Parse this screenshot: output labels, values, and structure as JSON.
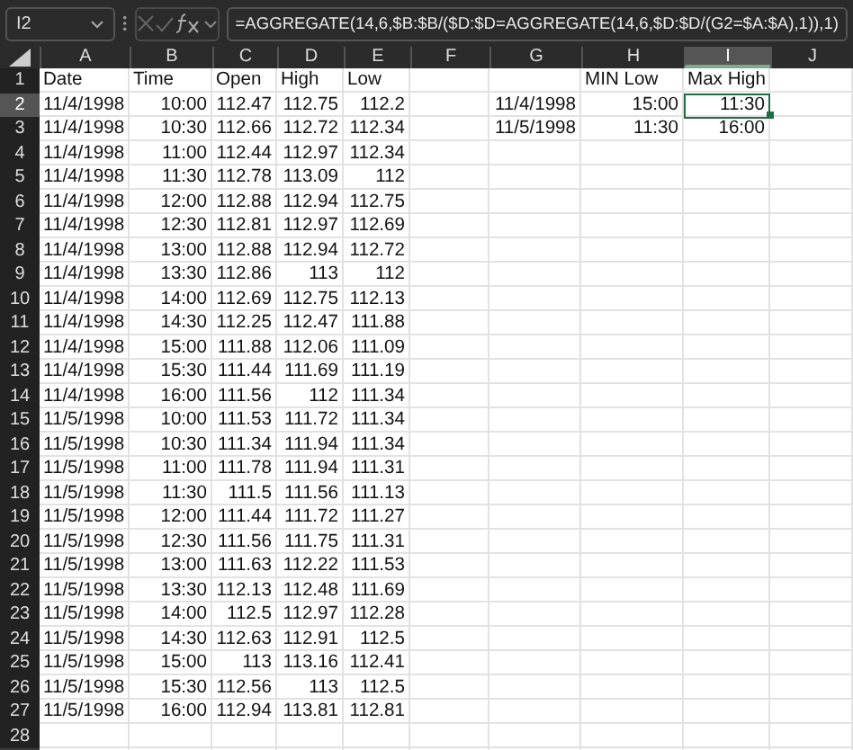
{
  "name_box": {
    "value": "I2"
  },
  "formula_bar": {
    "formula": "=AGGREGATE(14,6,$B:$B/($D:$D=AGGREGATE(14,6,$D:$D/(G2=$A:$A),1)),1)"
  },
  "columns": [
    {
      "label": "A",
      "selected": false
    },
    {
      "label": "B",
      "selected": false
    },
    {
      "label": "C",
      "selected": false
    },
    {
      "label": "D",
      "selected": false
    },
    {
      "label": "E",
      "selected": false
    },
    {
      "label": "F",
      "selected": false
    },
    {
      "label": "G",
      "selected": false
    },
    {
      "label": "H",
      "selected": false
    },
    {
      "label": "I",
      "selected": true
    },
    {
      "label": "J",
      "selected": false
    }
  ],
  "rows": [
    {
      "number": "1",
      "selected": false,
      "kind": "header",
      "cells": {
        "A": "Date",
        "B": "Time",
        "C": "Open",
        "D": "High",
        "E": "Low",
        "H": "MIN Low",
        "I": "Max High"
      }
    },
    {
      "number": "2",
      "selected": true,
      "kind": "data",
      "cells": {
        "A": "11/4/1998",
        "B": "10:00",
        "C": "112.47",
        "D": "112.75",
        "E": "112.2",
        "G": "11/4/1998",
        "H": "15:00",
        "I": "11:30"
      }
    },
    {
      "number": "3",
      "selected": false,
      "kind": "data",
      "cells": {
        "A": "11/4/1998",
        "B": "10:30",
        "C": "112.66",
        "D": "112.72",
        "E": "112.34",
        "G": "11/5/1998",
        "H": "11:30",
        "I": "16:00"
      }
    },
    {
      "number": "4",
      "selected": false,
      "kind": "data",
      "cells": {
        "A": "11/4/1998",
        "B": "11:00",
        "C": "112.44",
        "D": "112.97",
        "E": "112.34"
      }
    },
    {
      "number": "5",
      "selected": false,
      "kind": "data",
      "cells": {
        "A": "11/4/1998",
        "B": "11:30",
        "C": "112.78",
        "D": "113.09",
        "E": "112"
      }
    },
    {
      "number": "6",
      "selected": false,
      "kind": "data",
      "cells": {
        "A": "11/4/1998",
        "B": "12:00",
        "C": "112.88",
        "D": "112.94",
        "E": "112.75"
      }
    },
    {
      "number": "7",
      "selected": false,
      "kind": "data",
      "cells": {
        "A": "11/4/1998",
        "B": "12:30",
        "C": "112.81",
        "D": "112.97",
        "E": "112.69"
      }
    },
    {
      "number": "8",
      "selected": false,
      "kind": "data",
      "cells": {
        "A": "11/4/1998",
        "B": "13:00",
        "C": "112.88",
        "D": "112.94",
        "E": "112.72"
      }
    },
    {
      "number": "9",
      "selected": false,
      "kind": "data",
      "cells": {
        "A": "11/4/1998",
        "B": "13:30",
        "C": "112.86",
        "D": "113",
        "E": "112"
      }
    },
    {
      "number": "10",
      "selected": false,
      "kind": "data",
      "cells": {
        "A": "11/4/1998",
        "B": "14:00",
        "C": "112.69",
        "D": "112.75",
        "E": "112.13"
      }
    },
    {
      "number": "11",
      "selected": false,
      "kind": "data",
      "cells": {
        "A": "11/4/1998",
        "B": "14:30",
        "C": "112.25",
        "D": "112.47",
        "E": "111.88"
      }
    },
    {
      "number": "12",
      "selected": false,
      "kind": "data",
      "cells": {
        "A": "11/4/1998",
        "B": "15:00",
        "C": "111.88",
        "D": "112.06",
        "E": "111.09"
      }
    },
    {
      "number": "13",
      "selected": false,
      "kind": "data",
      "cells": {
        "A": "11/4/1998",
        "B": "15:30",
        "C": "111.44",
        "D": "111.69",
        "E": "111.19"
      }
    },
    {
      "number": "14",
      "selected": false,
      "kind": "data",
      "cells": {
        "A": "11/4/1998",
        "B": "16:00",
        "C": "111.56",
        "D": "112",
        "E": "111.34"
      }
    },
    {
      "number": "15",
      "selected": false,
      "kind": "data",
      "cells": {
        "A": "11/5/1998",
        "B": "10:00",
        "C": "111.53",
        "D": "111.72",
        "E": "111.34"
      }
    },
    {
      "number": "16",
      "selected": false,
      "kind": "data",
      "cells": {
        "A": "11/5/1998",
        "B": "10:30",
        "C": "111.34",
        "D": "111.94",
        "E": "111.34"
      }
    },
    {
      "number": "17",
      "selected": false,
      "kind": "data",
      "cells": {
        "A": "11/5/1998",
        "B": "11:00",
        "C": "111.78",
        "D": "111.94",
        "E": "111.31"
      }
    },
    {
      "number": "18",
      "selected": false,
      "kind": "data",
      "cells": {
        "A": "11/5/1998",
        "B": "11:30",
        "C": "111.5",
        "D": "111.56",
        "E": "111.13"
      }
    },
    {
      "number": "19",
      "selected": false,
      "kind": "data",
      "cells": {
        "A": "11/5/1998",
        "B": "12:00",
        "C": "111.44",
        "D": "111.72",
        "E": "111.27"
      }
    },
    {
      "number": "20",
      "selected": false,
      "kind": "data",
      "cells": {
        "A": "11/5/1998",
        "B": "12:30",
        "C": "111.56",
        "D": "111.75",
        "E": "111.31"
      }
    },
    {
      "number": "21",
      "selected": false,
      "kind": "data",
      "cells": {
        "A": "11/5/1998",
        "B": "13:00",
        "C": "111.63",
        "D": "112.22",
        "E": "111.53"
      }
    },
    {
      "number": "22",
      "selected": false,
      "kind": "data",
      "cells": {
        "A": "11/5/1998",
        "B": "13:30",
        "C": "112.13",
        "D": "112.48",
        "E": "111.69"
      }
    },
    {
      "number": "23",
      "selected": false,
      "kind": "data",
      "cells": {
        "A": "11/5/1998",
        "B": "14:00",
        "C": "112.5",
        "D": "112.97",
        "E": "112.28"
      }
    },
    {
      "number": "24",
      "selected": false,
      "kind": "data",
      "cells": {
        "A": "11/5/1998",
        "B": "14:30",
        "C": "112.63",
        "D": "112.91",
        "E": "112.5"
      }
    },
    {
      "number": "25",
      "selected": false,
      "kind": "data",
      "cells": {
        "A": "11/5/1998",
        "B": "15:00",
        "C": "113",
        "D": "113.16",
        "E": "112.41"
      }
    },
    {
      "number": "26",
      "selected": false,
      "kind": "data",
      "cells": {
        "A": "11/5/1998",
        "B": "15:30",
        "C": "112.56",
        "D": "113",
        "E": "112.5"
      }
    },
    {
      "number": "27",
      "selected": false,
      "kind": "data",
      "cells": {
        "A": "11/5/1998",
        "B": "16:00",
        "C": "112.94",
        "D": "113.81",
        "E": "112.81"
      }
    },
    {
      "number": "28",
      "selected": false
    }
  ]
}
